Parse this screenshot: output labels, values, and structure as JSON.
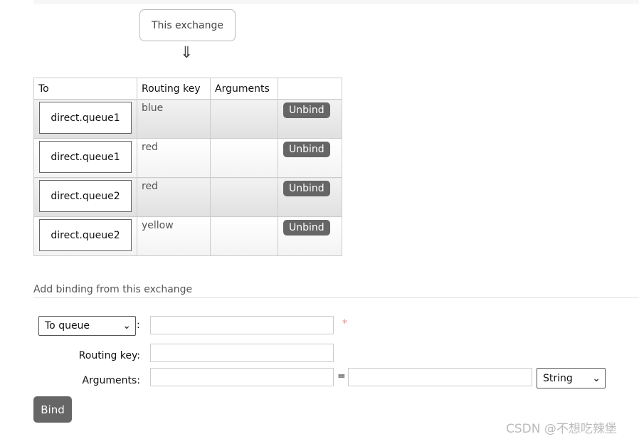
{
  "exchange_box": "This exchange",
  "arrow": "⇓",
  "table": {
    "headers": [
      "To",
      "Routing key",
      "Arguments",
      ""
    ],
    "rows": [
      {
        "to": "direct.queue1",
        "routing_key": "blue",
        "arguments": "",
        "action": "Unbind"
      },
      {
        "to": "direct.queue1",
        "routing_key": "red",
        "arguments": "",
        "action": "Unbind"
      },
      {
        "to": "direct.queue2",
        "routing_key": "red",
        "arguments": "",
        "action": "Unbind"
      },
      {
        "to": "direct.queue2",
        "routing_key": "yellow",
        "arguments": "",
        "action": "Unbind"
      }
    ]
  },
  "add_binding": {
    "title": "Add binding from this exchange",
    "destination_type": "To queue",
    "colon": ":",
    "required_mark": "*",
    "routing_key_label": "Routing key:",
    "arguments_label": "Arguments:",
    "equals": "=",
    "arg_type": "String",
    "bind_button": "Bind"
  },
  "watermark": "CSDN @不想吃辣堡"
}
